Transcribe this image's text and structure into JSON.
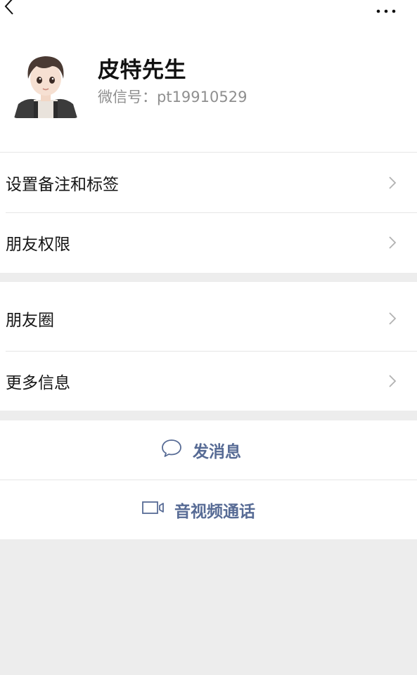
{
  "header": {
    "back_icon": "chevron-left-icon",
    "more_icon": "more-horizontal-icon"
  },
  "profile": {
    "name": "皮特先生",
    "wechat_id": "微信号：pt19910529"
  },
  "rows_group1": [
    {
      "label": "设置备注和标签"
    },
    {
      "label": "朋友权限"
    }
  ],
  "rows_group2": [
    {
      "label": "朋友圈"
    },
    {
      "label": "更多信息"
    }
  ],
  "actions": {
    "message_label": "发消息",
    "call_label": "音视频通话"
  },
  "colors": {
    "accent": "#576b95",
    "background": "#ededed",
    "divider": "#e6e6e6"
  }
}
